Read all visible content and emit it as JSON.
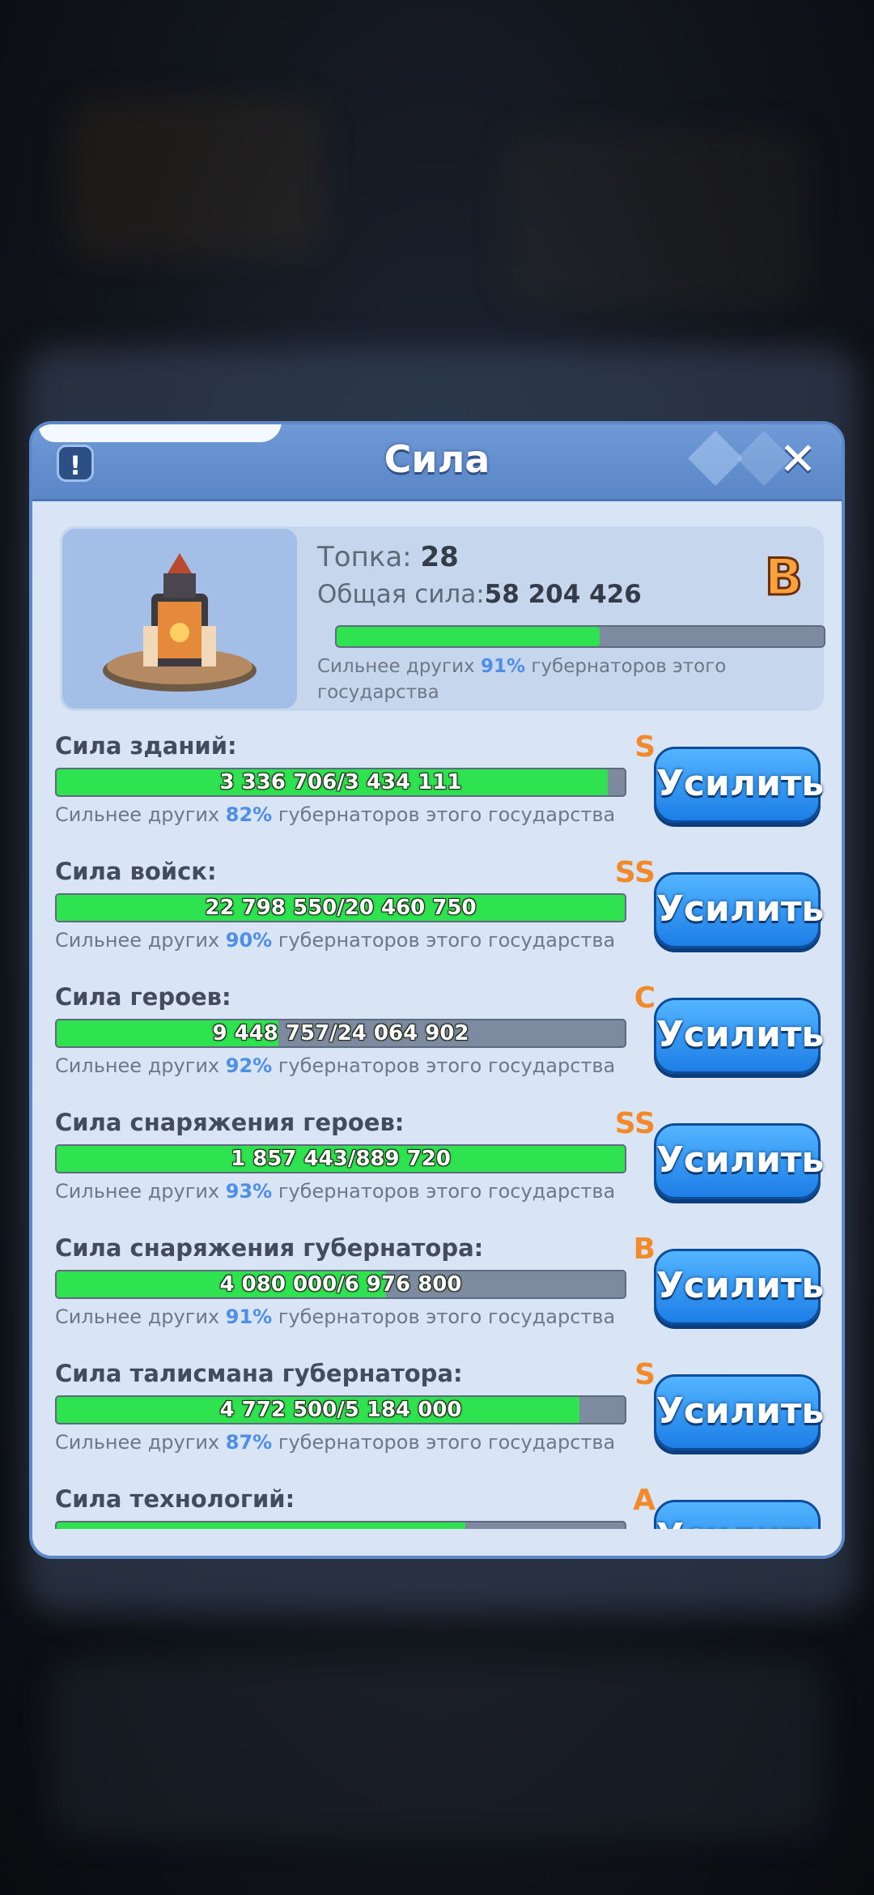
{
  "header": {
    "title": "Сила"
  },
  "top": {
    "building_label": "Топка: ",
    "building_level": "28",
    "total_label": "Общая сила:",
    "total_value": "58 204 426",
    "grade": "B",
    "progress": 0.54,
    "note_prefix": "Сильнее других ",
    "note_pct": "91%",
    "note_suffix": " губернаторов этого государства"
  },
  "boost_label": "Усилить",
  "rows": [
    {
      "label": "Сила зданий:",
      "grade": "S",
      "value": "3 336 706/3 434 111",
      "progress": 0.97,
      "note_prefix": "Сильнее других ",
      "pct": "82%",
      "note_suffix": " губернаторов этого государства"
    },
    {
      "label": "Сила войск:",
      "grade": "SS",
      "value": "22 798 550/20 460 750",
      "progress": 1.0,
      "note_prefix": "Сильнее других ",
      "pct": "90%",
      "note_suffix": " губернаторов этого государства"
    },
    {
      "label": "Сила героев:",
      "grade": "C",
      "value": "9 448 757/24 064 902",
      "progress": 0.39,
      "note_prefix": "Сильнее других ",
      "pct": "92%",
      "note_suffix": " губернаторов этого государства"
    },
    {
      "label": "Сила снаряжения героев:",
      "grade": "SS",
      "value": "1 857 443/889 720",
      "progress": 1.0,
      "note_prefix": "Сильнее других ",
      "pct": "93%",
      "note_suffix": " губернаторов этого государства"
    },
    {
      "label": "Сила снаряжения губернатора:",
      "grade": "B",
      "value": "4 080 000/6 976 800",
      "progress": 0.58,
      "note_prefix": "Сильнее других ",
      "pct": "91%",
      "note_suffix": " губернаторов этого государства"
    },
    {
      "label": "Сила талисмана губернатора:",
      "grade": "S",
      "value": "4 772 500/5 184 000",
      "progress": 0.92,
      "note_prefix": "Сильнее других ",
      "pct": "87%",
      "note_suffix": " губернаторов этого государства"
    },
    {
      "label": "Сила технологий:",
      "grade": "A",
      "value": "",
      "progress": 0.72,
      "note_prefix": "",
      "pct": "",
      "note_suffix": ""
    }
  ]
}
